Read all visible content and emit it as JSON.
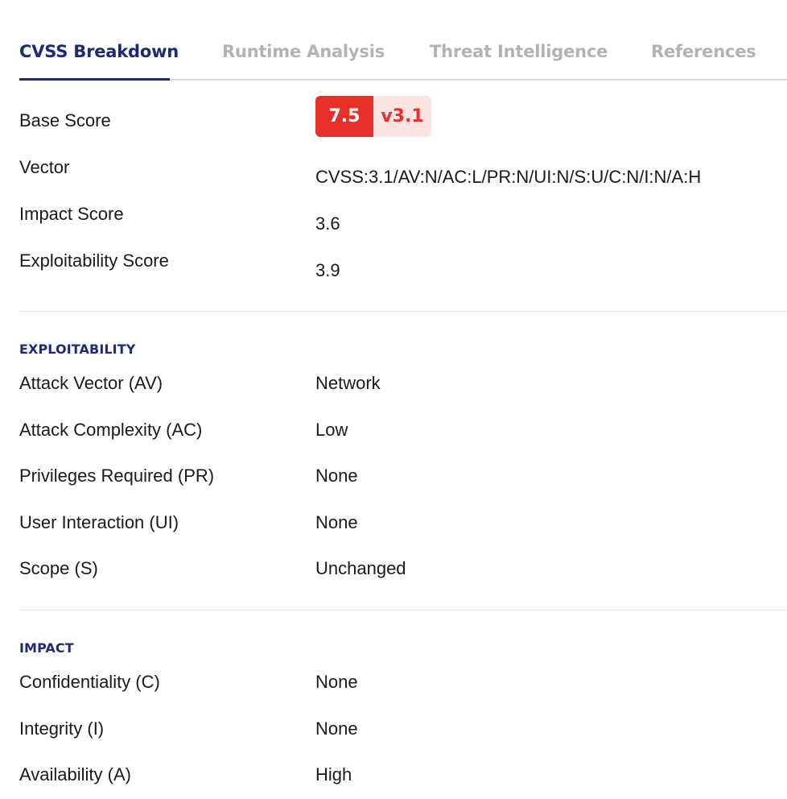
{
  "tabs": [
    {
      "label": "CVSS Breakdown",
      "active": true
    },
    {
      "label": "Runtime Analysis",
      "active": false
    },
    {
      "label": "Threat Intelligence",
      "active": false
    },
    {
      "label": "References",
      "active": false
    }
  ],
  "summary": {
    "base_score": {
      "label": "Base Score",
      "score": "7.5",
      "version": "v3.1"
    },
    "vector": {
      "label": "Vector",
      "value": "CVSS:3.1/AV:N/AC:L/PR:N/UI:N/S:U/C:N/I:N/A:H"
    },
    "impact_score": {
      "label": "Impact Score",
      "value": "3.6"
    },
    "exploitability_score": {
      "label": "Exploitability Score",
      "value": "3.9"
    }
  },
  "exploitability": {
    "title": "EXPLOITABILITY",
    "rows": [
      {
        "label": "Attack Vector (AV)",
        "value": "Network"
      },
      {
        "label": "Attack Complexity (AC)",
        "value": "Low"
      },
      {
        "label": "Privileges Required (PR)",
        "value": "None"
      },
      {
        "label": "User Interaction (UI)",
        "value": "None"
      },
      {
        "label": "Scope (S)",
        "value": "Unchanged"
      }
    ]
  },
  "impact": {
    "title": "IMPACT",
    "rows": [
      {
        "label": "Confidentiality (C)",
        "value": "None"
      },
      {
        "label": "Integrity (I)",
        "value": "None"
      },
      {
        "label": "Availability (A)",
        "value": "High"
      }
    ]
  },
  "colors": {
    "accent": "#1e2a78",
    "severity_high": "#e8302a",
    "severity_high_bg": "#fce4e2",
    "tab_inactive": "#b3b3b3"
  }
}
